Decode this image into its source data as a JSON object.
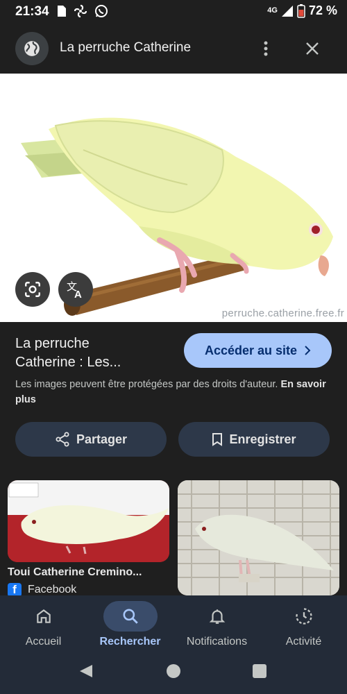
{
  "status_bar": {
    "time": "21:34",
    "network": "4G",
    "battery": "72 %",
    "icons": [
      "document-icon",
      "fan-icon",
      "whatsapp-icon",
      "signal-icon",
      "battery-icon"
    ]
  },
  "app_bar": {
    "title": "La perruche Catherine",
    "icons": [
      "globe-icon",
      "more-vert-icon",
      "close-icon"
    ]
  },
  "image": {
    "watermark": "perruche.catherine.free.fr",
    "icons": [
      "lens-icon",
      "translate-icon"
    ]
  },
  "result": {
    "title_line1": "La perruche",
    "title_line2": "Catherine : Les...",
    "visit_label": "Accéder au site",
    "copyright_text": "Les images peuvent être protégées par des droits d'auteur.",
    "learn_more": "En savoir plus"
  },
  "actions": {
    "share_label": "Partager",
    "save_label": "Enregistrer"
  },
  "related": {
    "card1_title": "Toui Catherine Cremino...",
    "card1_source": "Facebook"
  },
  "bottom_nav": {
    "items": [
      {
        "label": "Accueil",
        "icon": "home-icon"
      },
      {
        "label": "Rechercher",
        "icon": "search-icon",
        "active": true
      },
      {
        "label": "Notifications",
        "icon": "bell-icon"
      },
      {
        "label": "Activité",
        "icon": "history-icon"
      }
    ]
  },
  "colors": {
    "background": "#1f1f1f",
    "accent": "#a8c7fa",
    "pill": "#2d3849",
    "nav": "#232b38"
  }
}
